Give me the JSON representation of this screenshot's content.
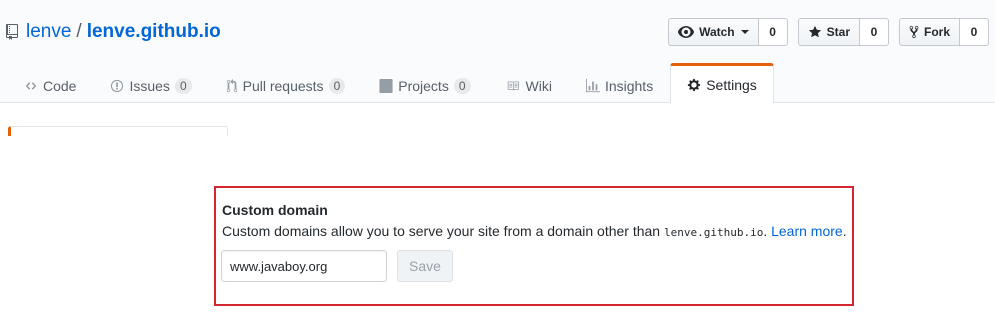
{
  "repo": {
    "owner": "lenve",
    "separator": "/",
    "name": "lenve.github.io"
  },
  "actions": {
    "watch": {
      "label": "Watch",
      "count": "0"
    },
    "star": {
      "label": "Star",
      "count": "0"
    },
    "fork": {
      "label": "Fork",
      "count": "0"
    }
  },
  "tabs": [
    {
      "label": "Code",
      "icon": "code-icon"
    },
    {
      "label": "Issues",
      "icon": "issue-icon",
      "count": "0"
    },
    {
      "label": "Pull requests",
      "icon": "pull-request-icon",
      "count": "0"
    },
    {
      "label": "Projects",
      "icon": "project-icon",
      "count": "0"
    },
    {
      "label": "Wiki",
      "icon": "book-icon"
    },
    {
      "label": "Insights",
      "icon": "graph-icon"
    },
    {
      "label": "Settings",
      "icon": "gear-icon",
      "selected": true
    }
  ],
  "custom_domain": {
    "title": "Custom domain",
    "description_prefix": "Custom domains allow you to serve your site from a domain other than ",
    "domain_code": "lenve.github.io",
    "description_suffix": ". ",
    "learn_more": "Learn more",
    "period": ".",
    "input_value": "www.javaboy.org",
    "save_label": "Save"
  },
  "colors": {
    "link": "#0366d6",
    "selected_tab_accent": "#e36209",
    "highlight_border": "#d5262f"
  }
}
